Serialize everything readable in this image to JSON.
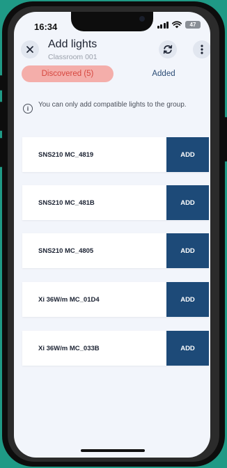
{
  "status_bar": {
    "time": "16:34",
    "battery": "47"
  },
  "header": {
    "title": "Add lights",
    "subtitle": "Classroom 001"
  },
  "tabs": {
    "discovered": "Discovered (5)",
    "added": "Added"
  },
  "info": {
    "message": "You can only add compatible lights to the group.",
    "icon": "i"
  },
  "lights": [
    {
      "name": "SNS210 MC_4819",
      "action": "ADD"
    },
    {
      "name": "SNS210 MC_481B",
      "action": "ADD"
    },
    {
      "name": "SNS210 MC_4805",
      "action": "ADD"
    },
    {
      "name": "Xi 36W/m MC_01D4",
      "action": "ADD"
    },
    {
      "name": "Xi 36W/m MC_033B",
      "action": "ADD"
    }
  ],
  "colors": {
    "accent": "#1d4a78",
    "tab_active_bg": "#f4aeaa",
    "tab_active_text": "#d6473f",
    "background": "#f2f5fb"
  }
}
